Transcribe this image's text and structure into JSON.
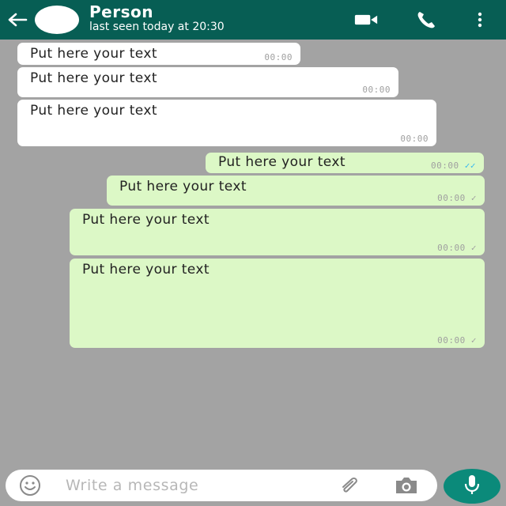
{
  "header": {
    "contact_name": "Person",
    "status": "last seen today at 20:30",
    "back_icon": "back-arrow-icon",
    "video_icon": "video-call-icon",
    "call_icon": "phone-icon",
    "menu_icon": "more-vertical-icon",
    "background_color": "#075e54"
  },
  "chat": {
    "background_color": "#a3a3a3",
    "messages": [
      {
        "direction": "incoming",
        "text": "Put here your text",
        "time": "00:00"
      },
      {
        "direction": "incoming",
        "text": "Put here your text",
        "time": "00:00"
      },
      {
        "direction": "incoming",
        "text": "Put here your text",
        "time": "00:00"
      },
      {
        "direction": "outgoing",
        "text": "Put here your text",
        "time": "00:00",
        "status": "read"
      },
      {
        "direction": "outgoing",
        "text": "Put here your text",
        "time": "00:00",
        "status": "sent"
      },
      {
        "direction": "outgoing",
        "text": "Put here your text",
        "time": "00:00",
        "status": "sent"
      },
      {
        "direction": "outgoing",
        "text": "Put here your text",
        "time": "00:00",
        "status": "sent"
      }
    ],
    "incoming_color": "#ffffff",
    "outgoing_color": "#dcf8c6"
  },
  "composer": {
    "placeholder": "Write a message",
    "value": "",
    "emoji_icon": "emoji-icon",
    "attach_icon": "paperclip-icon",
    "camera_icon": "camera-icon",
    "mic_icon": "microphone-icon",
    "accent_color": "#0b8a7a"
  }
}
